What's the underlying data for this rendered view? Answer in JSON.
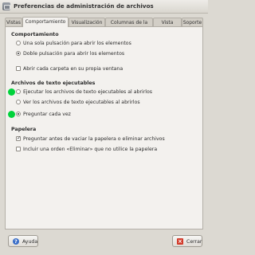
{
  "window": {
    "title": "Preferencias de administración de archivos",
    "icon": "file-manager-icon"
  },
  "tabs": [
    {
      "label": "Vistas"
    },
    {
      "label": "Comportamiento",
      "active": true
    },
    {
      "label": "Visualización"
    },
    {
      "label": "Columnas de la lista"
    },
    {
      "label": "Vista previa"
    },
    {
      "label": "Soporte"
    }
  ],
  "behavior": {
    "title": "Comportamiento",
    "options": [
      {
        "label": "Una sola pulsación para abrir los elementos",
        "selected": false
      },
      {
        "label": "Doble pulsación para abrir los elementos",
        "selected": true
      }
    ],
    "checkbox": {
      "label": "Abrir cada carpeta en su propia ventana",
      "checked": false
    }
  },
  "executables": {
    "title": "Archivos de texto ejecutables",
    "options": [
      {
        "label": "Ejecutar los archivos de texto ejecutables al abrirlos",
        "selected": false
      },
      {
        "label": "Ver los archivos de texto ejecutables al abrirlos",
        "selected": false
      },
      {
        "label": "Preguntar cada vez",
        "selected": true
      }
    ]
  },
  "trash": {
    "title": "Papelera",
    "checkboxes": [
      {
        "label": "Preguntar antes de vaciar la papelera o eliminar archivos",
        "checked": true
      },
      {
        "label": "Incluir una orden «Eliminar» que no utilice la papelera",
        "checked": false
      }
    ]
  },
  "buttons": {
    "help": "Ayuda",
    "close": "Cerrar"
  },
  "colors": {
    "marker": "#00d23b"
  }
}
